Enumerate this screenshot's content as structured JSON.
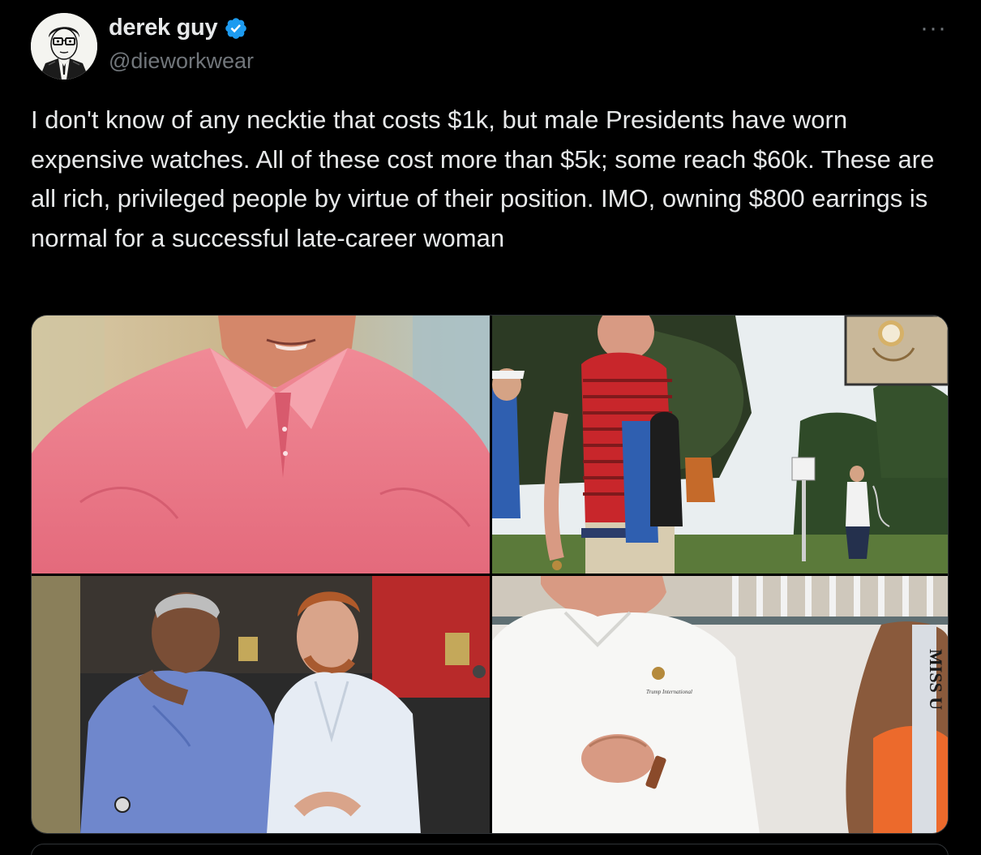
{
  "author": {
    "display_name": "derek guy",
    "handle": "@dieworkwear",
    "verified": true,
    "verified_color": "#1d9bf0"
  },
  "more_label": "···",
  "tweet": {
    "text": "I don't know of any necktie that costs $1k, but male Presidents have worn expensive watches. All of these cost more than $5k; some reach $60k. These are all rich, privileged people by virtue of their position. IMO, owning $800 earrings is normal for a successful late-career woman"
  },
  "media": {
    "count": 4,
    "photos": [
      {
        "name": "photo-pink-polo"
      },
      {
        "name": "photo-golf-course"
      },
      {
        "name": "photo-two-men-seated"
      },
      {
        "name": "photo-white-polo-watch"
      }
    ],
    "photo_4_sash_text": "MISS U"
  },
  "colors": {
    "background": "#000000",
    "text": "#e7e9ea",
    "secondary": "#71767b",
    "border": "#2f3336"
  }
}
